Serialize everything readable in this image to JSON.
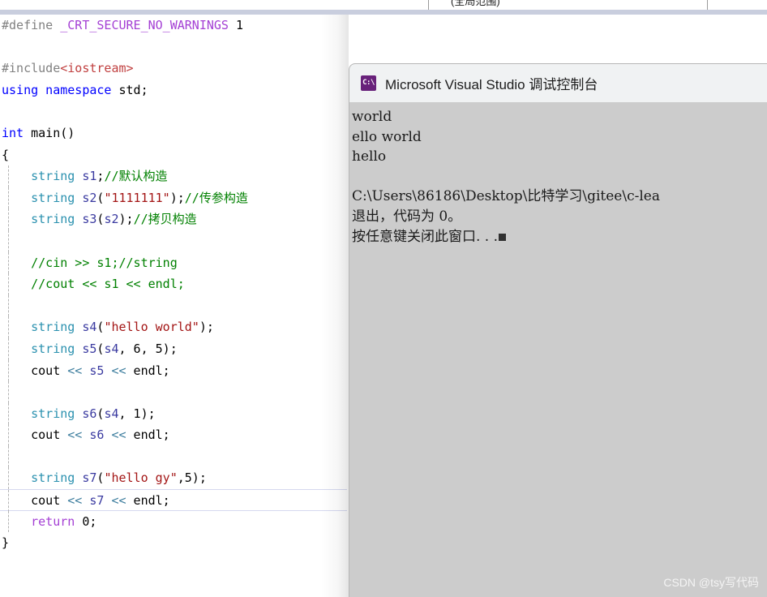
{
  "top_chrome": {
    "scope_text": "(全局范围)"
  },
  "editor": {
    "name": "code-editor",
    "language": "C++",
    "current_line_index": 18,
    "lines": [
      {
        "indent": 0,
        "guide": false,
        "tokens": [
          {
            "cls": "t-pp",
            "text": "#define"
          },
          {
            "cls": "t-plain",
            "text": " "
          },
          {
            "cls": "t-macro",
            "text": "_CRT_SECURE_NO_WARNINGS"
          },
          {
            "cls": "t-plain",
            "text": " "
          },
          {
            "cls": "t-num",
            "text": "1"
          }
        ]
      },
      {
        "indent": 0,
        "guide": false,
        "tokens": []
      },
      {
        "indent": 0,
        "guide": false,
        "tokens": [
          {
            "cls": "t-pp",
            "text": "#include"
          },
          {
            "cls": "t-inc",
            "text": "<iostream>"
          }
        ]
      },
      {
        "indent": 0,
        "guide": false,
        "tokens": [
          {
            "cls": "t-kw",
            "text": "using namespace"
          },
          {
            "cls": "t-plain",
            "text": " std;"
          }
        ]
      },
      {
        "indent": 0,
        "guide": false,
        "tokens": []
      },
      {
        "indent": 0,
        "guide": false,
        "tokens": [
          {
            "cls": "t-kw",
            "text": "int"
          },
          {
            "cls": "t-plain",
            "text": " main()"
          }
        ]
      },
      {
        "indent": 0,
        "guide": false,
        "tokens": [
          {
            "cls": "t-plain",
            "text": "{"
          }
        ]
      },
      {
        "indent": 1,
        "guide": true,
        "tokens": [
          {
            "cls": "t-type",
            "text": "string"
          },
          {
            "cls": "t-plain",
            "text": " "
          },
          {
            "cls": "t-id",
            "text": "s1"
          },
          {
            "cls": "t-plain",
            "text": ";"
          },
          {
            "cls": "t-cmt",
            "text": "//默认构造"
          }
        ]
      },
      {
        "indent": 1,
        "guide": true,
        "tokens": [
          {
            "cls": "t-type",
            "text": "string"
          },
          {
            "cls": "t-plain",
            "text": " "
          },
          {
            "cls": "t-id",
            "text": "s2"
          },
          {
            "cls": "t-plain",
            "text": "("
          },
          {
            "cls": "t-str",
            "text": "\"1111111\""
          },
          {
            "cls": "t-plain",
            "text": ");"
          },
          {
            "cls": "t-cmt",
            "text": "//传参构造"
          }
        ]
      },
      {
        "indent": 1,
        "guide": true,
        "tokens": [
          {
            "cls": "t-type",
            "text": "string"
          },
          {
            "cls": "t-plain",
            "text": " "
          },
          {
            "cls": "t-id",
            "text": "s3"
          },
          {
            "cls": "t-plain",
            "text": "("
          },
          {
            "cls": "t-id",
            "text": "s2"
          },
          {
            "cls": "t-plain",
            "text": ");"
          },
          {
            "cls": "t-cmt",
            "text": "//拷贝构造"
          }
        ]
      },
      {
        "indent": 1,
        "guide": true,
        "tokens": []
      },
      {
        "indent": 1,
        "guide": true,
        "tokens": [
          {
            "cls": "t-cmt",
            "text": "//cin >> s1;//string"
          }
        ]
      },
      {
        "indent": 1,
        "guide": true,
        "tokens": [
          {
            "cls": "t-cmt",
            "text": "//cout << s1 << endl;"
          }
        ]
      },
      {
        "indent": 1,
        "guide": true,
        "tokens": []
      },
      {
        "indent": 1,
        "guide": true,
        "tokens": [
          {
            "cls": "t-type",
            "text": "string"
          },
          {
            "cls": "t-plain",
            "text": " "
          },
          {
            "cls": "t-id",
            "text": "s4"
          },
          {
            "cls": "t-plain",
            "text": "("
          },
          {
            "cls": "t-str",
            "text": "\"hello world\""
          },
          {
            "cls": "t-plain",
            "text": ");"
          }
        ]
      },
      {
        "indent": 1,
        "guide": true,
        "tokens": [
          {
            "cls": "t-type",
            "text": "string"
          },
          {
            "cls": "t-plain",
            "text": " "
          },
          {
            "cls": "t-id",
            "text": "s5"
          },
          {
            "cls": "t-plain",
            "text": "("
          },
          {
            "cls": "t-id",
            "text": "s4"
          },
          {
            "cls": "t-plain",
            "text": ", 6, 5);"
          }
        ]
      },
      {
        "indent": 1,
        "guide": true,
        "tokens": [
          {
            "cls": "t-plain",
            "text": "cout "
          },
          {
            "cls": "t-op",
            "text": "<<"
          },
          {
            "cls": "t-plain",
            "text": " "
          },
          {
            "cls": "t-id",
            "text": "s5"
          },
          {
            "cls": "t-plain",
            "text": " "
          },
          {
            "cls": "t-op",
            "text": "<<"
          },
          {
            "cls": "t-plain",
            "text": " endl;"
          }
        ]
      },
      {
        "indent": 1,
        "guide": true,
        "tokens": []
      },
      {
        "indent": 1,
        "guide": true,
        "tokens": [
          {
            "cls": "t-type",
            "text": "string"
          },
          {
            "cls": "t-plain",
            "text": " "
          },
          {
            "cls": "t-id",
            "text": "s6"
          },
          {
            "cls": "t-plain",
            "text": "("
          },
          {
            "cls": "t-id",
            "text": "s4"
          },
          {
            "cls": "t-plain",
            "text": ", 1);"
          }
        ]
      },
      {
        "indent": 1,
        "guide": true,
        "tokens": [
          {
            "cls": "t-plain",
            "text": "cout "
          },
          {
            "cls": "t-op",
            "text": "<<"
          },
          {
            "cls": "t-plain",
            "text": " "
          },
          {
            "cls": "t-id",
            "text": "s6"
          },
          {
            "cls": "t-plain",
            "text": " "
          },
          {
            "cls": "t-op",
            "text": "<<"
          },
          {
            "cls": "t-plain",
            "text": " endl;"
          }
        ]
      },
      {
        "indent": 1,
        "guide": true,
        "tokens": []
      },
      {
        "indent": 1,
        "guide": true,
        "tokens": [
          {
            "cls": "t-type",
            "text": "string"
          },
          {
            "cls": "t-plain",
            "text": " "
          },
          {
            "cls": "t-id",
            "text": "s7"
          },
          {
            "cls": "t-plain",
            "text": "("
          },
          {
            "cls": "t-str",
            "text": "\"hello gy\""
          },
          {
            "cls": "t-plain",
            "text": ",5);"
          }
        ]
      },
      {
        "indent": 1,
        "guide": true,
        "current": true,
        "tokens": [
          {
            "cls": "t-plain",
            "text": "cout "
          },
          {
            "cls": "t-op",
            "text": "<<"
          },
          {
            "cls": "t-plain",
            "text": " "
          },
          {
            "cls": "t-id",
            "text": "s7"
          },
          {
            "cls": "t-plain",
            "text": " "
          },
          {
            "cls": "t-op",
            "text": "<<"
          },
          {
            "cls": "t-plain",
            "text": " endl;"
          }
        ]
      },
      {
        "indent": 1,
        "guide": true,
        "tokens": [
          {
            "cls": "t-ctl",
            "text": "return"
          },
          {
            "cls": "t-plain",
            "text": " 0;"
          }
        ]
      },
      {
        "indent": 0,
        "guide": false,
        "tokens": [
          {
            "cls": "t-plain",
            "text": "}"
          }
        ]
      }
    ]
  },
  "console_window": {
    "title": "Microsoft Visual Studio 调试控制台",
    "icon": "console-app-icon",
    "icon_glyph": "C:\\",
    "output_lines": [
      "world",
      "ello world",
      "hello",
      "",
      "C:\\Users\\86186\\Desktop\\比特学习\\gitee\\c-lea",
      "退出，代码为 0。",
      "按任意键关闭此窗口. . ."
    ],
    "caret_visible": true,
    "background_color": "#cccccc",
    "titlebar_color": "#f0f2f3",
    "icon_color": "#68217a"
  },
  "watermark": {
    "text": "CSDN @tsy写代码"
  }
}
